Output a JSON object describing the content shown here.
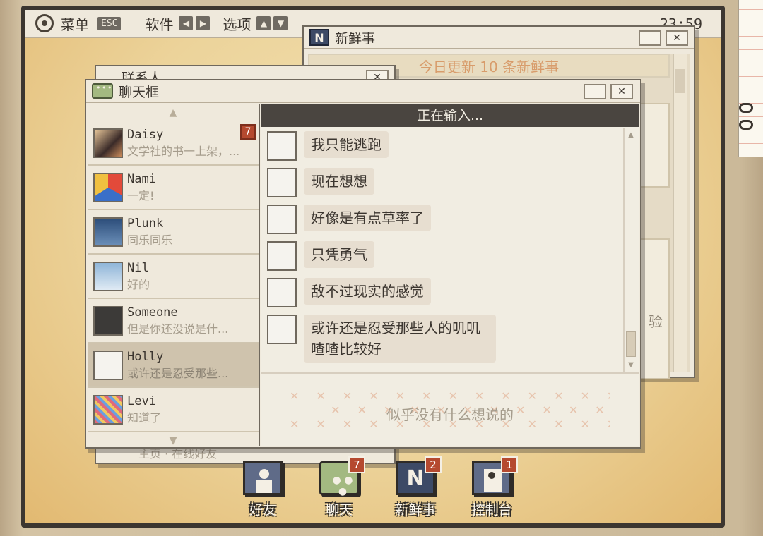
{
  "menubar": {
    "menu_label": "菜单",
    "menu_key": "ESC",
    "software_label": "软件",
    "software_prev": "◀",
    "software_next": "▶",
    "options_label": "选项",
    "options_up": "▲",
    "options_down": "▼",
    "clock": "23:59"
  },
  "news_window": {
    "title": "新鲜事",
    "icon": "N",
    "banner": "今日更新 10 条新鲜事",
    "min_label": "",
    "close_label": "✕",
    "partial_text": "验"
  },
  "contacts_window": {
    "title": "联系人",
    "close_label": "✕",
    "bottom_text": "主页 · 在线好友"
  },
  "chat_window": {
    "title": "聊天框",
    "close_label": "✕",
    "status": "正在输入...",
    "input_placeholder": "似乎没有什么想说的",
    "contacts": [
      {
        "name": "Daisy",
        "preview": "文学社的书一上架，...",
        "unread": "7",
        "avatar": "daisy-avatar",
        "active": false
      },
      {
        "name": "Nami",
        "preview": "一定!",
        "unread": "",
        "avatar": "nami-avatar",
        "active": false
      },
      {
        "name": "Plunk",
        "preview": "同乐同乐",
        "unread": "",
        "avatar": "plunk-avatar",
        "active": false
      },
      {
        "name": "Nil",
        "preview": "好的",
        "unread": "",
        "avatar": "nil-avatar",
        "active": false
      },
      {
        "name": "Someone",
        "preview": "但是你还没说是什...",
        "unread": "",
        "avatar": "someone-avatar",
        "active": false
      },
      {
        "name": "Holly",
        "preview": "或许还是忍受那些...",
        "unread": "",
        "avatar": "holly-avatar",
        "active": true
      },
      {
        "name": "Levi",
        "preview": "知道了",
        "unread": "",
        "avatar": "levi-avatar",
        "active": false
      }
    ],
    "messages": [
      {
        "text": "我只能逃跑"
      },
      {
        "text": "现在想想"
      },
      {
        "text": "好像是有点草率了"
      },
      {
        "text": "只凭勇气"
      },
      {
        "text": "敌不过现实的感觉"
      },
      {
        "text": "或许还是忍受那些人的叽叽喳喳比较好"
      }
    ]
  },
  "dock": [
    {
      "label": "好友",
      "badge": "",
      "icon": "friends-icon"
    },
    {
      "label": "聊天",
      "badge": "7",
      "icon": "chat-icon"
    },
    {
      "label": "新鲜事",
      "badge": "2",
      "icon": "news-icon"
    },
    {
      "label": "控制台",
      "badge": "1",
      "icon": "console-icon"
    }
  ],
  "colors": {
    "accent": "#b5492f",
    "window_bg": "#efe9dc",
    "header_dark": "#4a4540",
    "desktop": "#ecd39a"
  }
}
